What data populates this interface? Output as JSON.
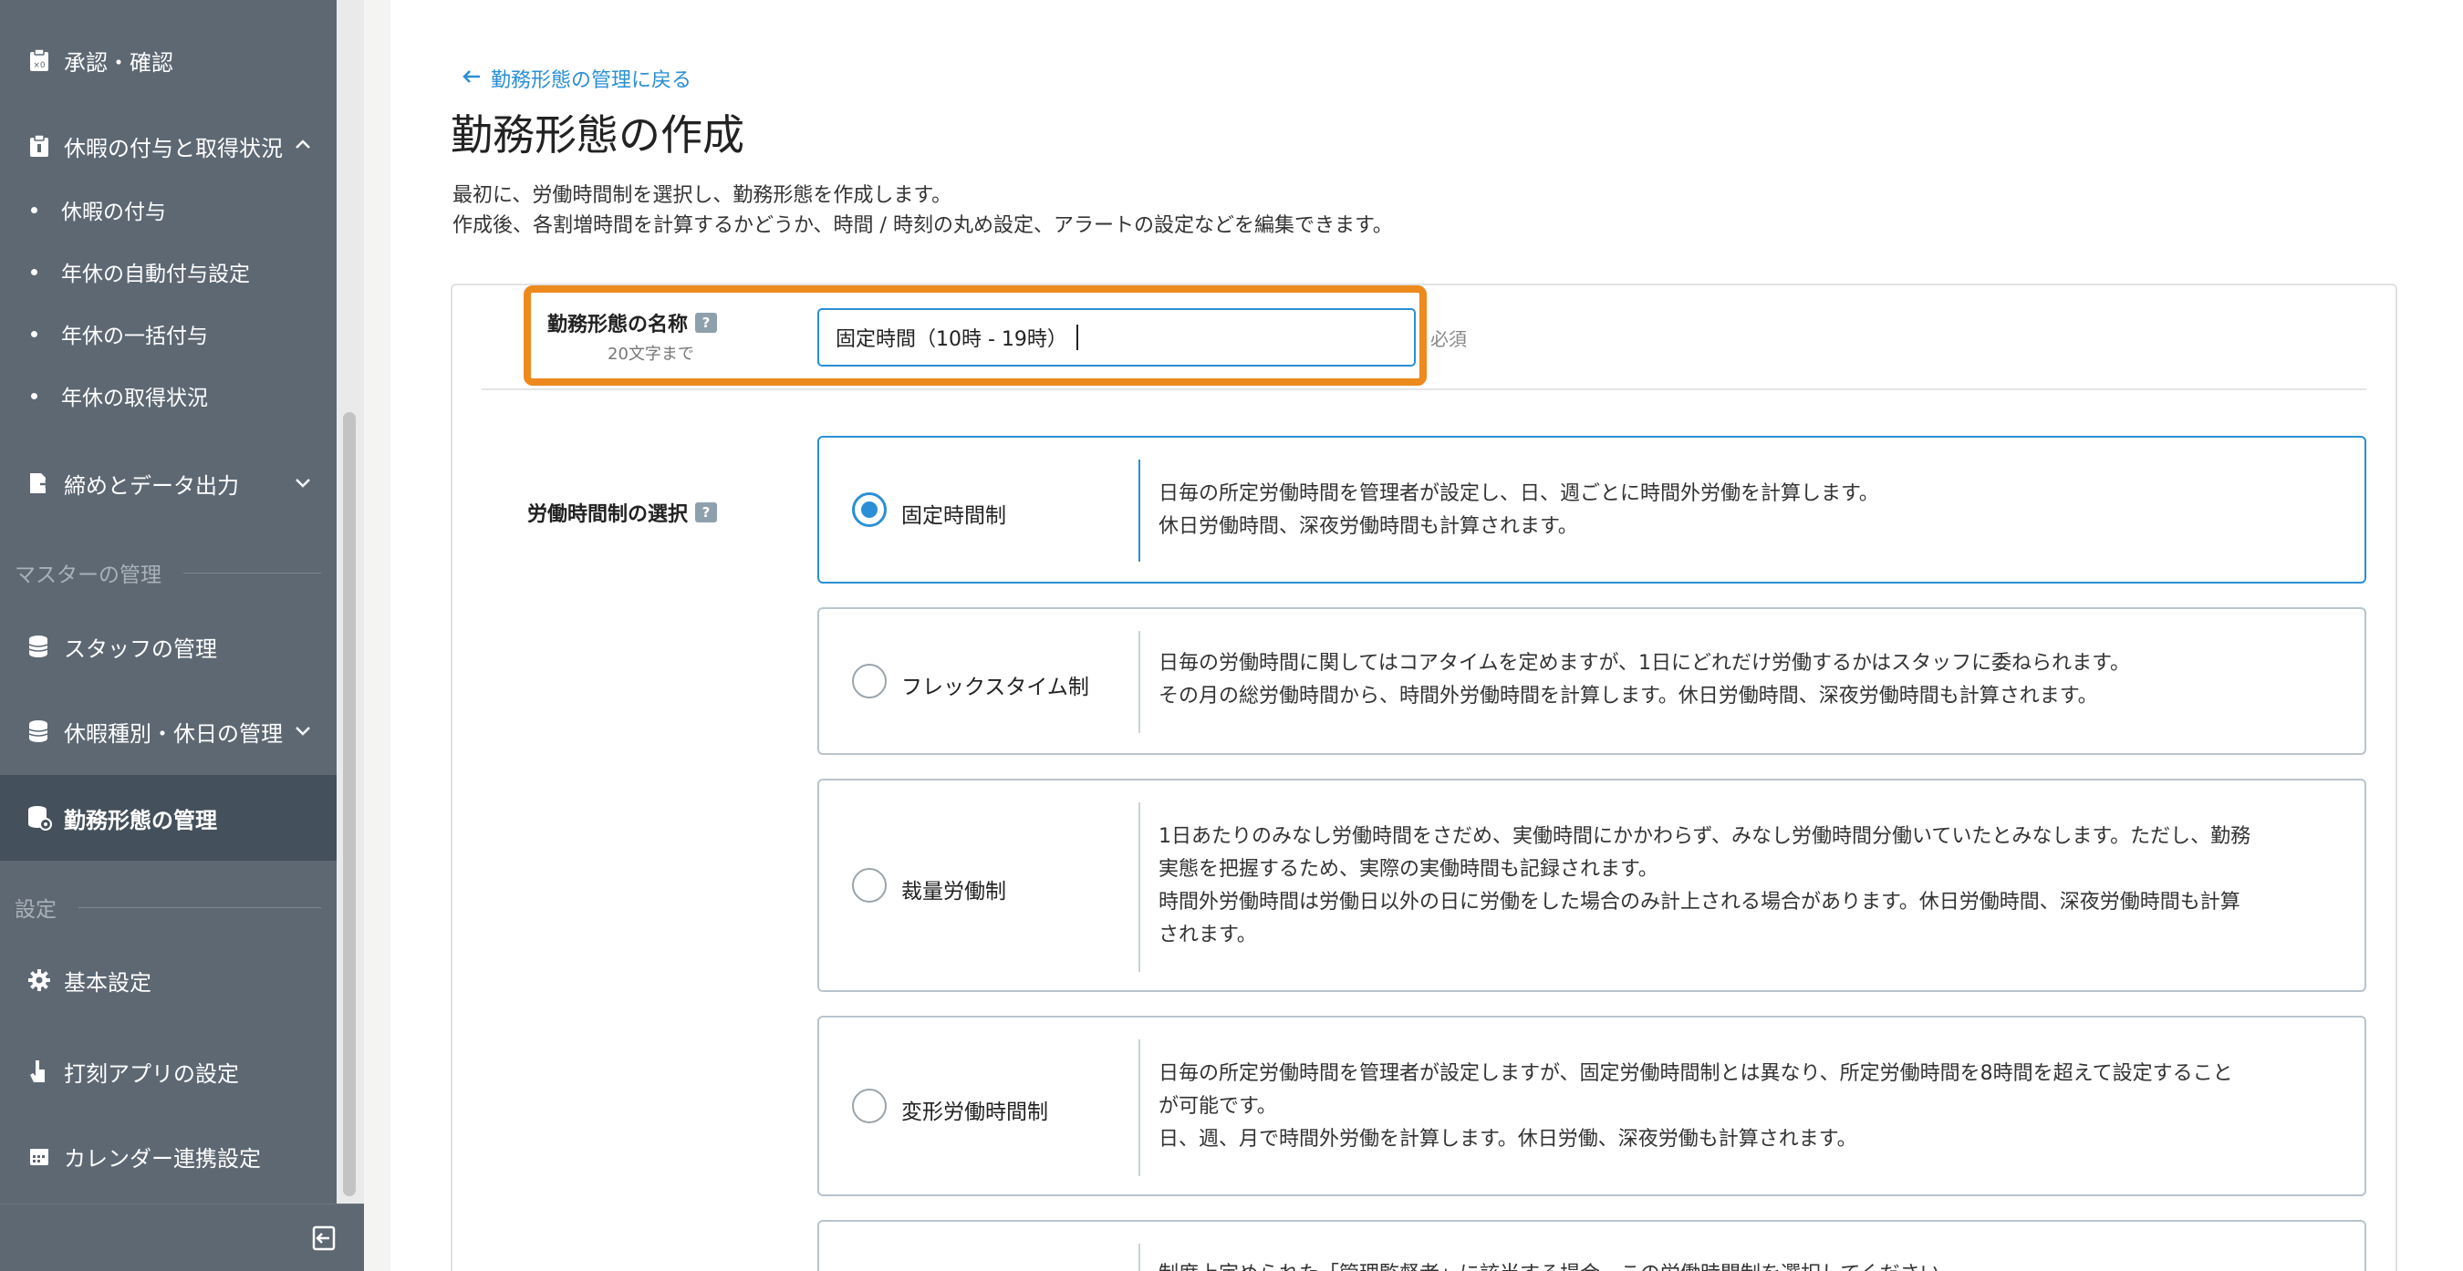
{
  "sidebar": {
    "items": [
      {
        "label": "承認・確認",
        "icon": "clipboard-check-icon"
      },
      {
        "label": "休暇の付与と取得状況",
        "icon": "clipboard-icon",
        "expanded": true
      }
    ],
    "sub_items": [
      "休暇の付与",
      "年休の自動付与設定",
      "年休の一括付与",
      "年休の取得状況"
    ],
    "items2": [
      {
        "label": "締めとデータ出力",
        "icon": "export-icon"
      }
    ],
    "section_master": "マスターの管理",
    "master_items": [
      {
        "label": "スタッフの管理",
        "icon": "database-icon"
      },
      {
        "label": "休暇種別・休日の管理",
        "icon": "database-icon"
      },
      {
        "label": "勤務形態の管理",
        "icon": "database-gear-icon"
      }
    ],
    "section_settings": "設定",
    "settings_items": [
      {
        "label": "基本設定",
        "icon": "gear-icon"
      },
      {
        "label": "打刻アプリの設定",
        "icon": "hand-icon"
      },
      {
        "label": "カレンダー連携設定",
        "icon": "calendar-icon"
      }
    ]
  },
  "main": {
    "back_link": "勤務形態の管理に戻る",
    "title": "勤務形態の作成",
    "desc_line1": "最初に、労働時間制を選択し、勤務形態を作成します。",
    "desc_line2": "作成後、各割増時間を計算するかどうか、時間 / 時刻の丸め設定、アラートの設定などを編集できます。",
    "name_field": {
      "label": "勤務形態の名称",
      "sub": "20文字まで",
      "value": "固定時間（10時 - 19時）",
      "required": "必須"
    },
    "system_field": {
      "label": "労働時間制の選択"
    },
    "options": [
      {
        "label": "固定時間制",
        "selected": true,
        "desc1": "日毎の所定労働時間を管理者が設定し、日、週ごとに時間外労働を計算します。",
        "desc2": "休日労働時間、深夜労働時間も計算されます。"
      },
      {
        "label": "フレックスタイム制",
        "selected": false,
        "desc1": "日毎の労働時間に関してはコアタイムを定めますが、1日にどれだけ労働するかはスタッフに委ねられます。",
        "desc2": "その月の総労働時間から、時間外労働時間を計算します。休日労働時間、深夜労働時間も計算されます。"
      },
      {
        "label": "裁量労働制",
        "selected": false,
        "desc1": "1日あたりのみなし労働時間をさだめ、実働時間にかかわらず、みなし労働時間分働いていたとみなします。ただし、勤務",
        "desc2": "実態を把握するため、実際の実働時間も記録されます。",
        "desc3": "時間外労働時間は労働日以外の日に労働をした場合のみ計上される場合があります。休日労働時間、深夜労働時間も計算",
        "desc4": "されます。"
      },
      {
        "label": "変形労働時間制",
        "selected": false,
        "desc1": "日毎の所定労働時間を管理者が設定しますが、固定労働時間制とは異なり、所定労働時間を8時間を超えて設定すること",
        "desc2": "が可能です。",
        "desc3": "日、週、月で時間外労働を計算します。休日労働、深夜労働も計算されます。"
      },
      {
        "label": "",
        "selected": false,
        "desc1": "制度上定められた「管理監督者」に該当する場合、この労働時間制を選択してください"
      }
    ]
  },
  "colors": {
    "accent": "#2a8fd6",
    "sidebar": "#5d6873",
    "highlight": "#ec8a1d"
  }
}
